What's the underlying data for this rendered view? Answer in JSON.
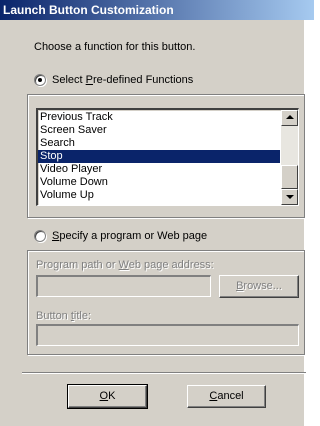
{
  "window": {
    "title": "Launch Button Customization"
  },
  "prompt": "Choose a function for this button.",
  "predefined": {
    "label_pre": "Select ",
    "label_accel": "P",
    "label_post": "re-defined Functions",
    "selected": true,
    "items": [
      {
        "label": "Previous Track",
        "selected": false
      },
      {
        "label": "Screen Saver",
        "selected": false
      },
      {
        "label": "Search",
        "selected": false
      },
      {
        "label": "Stop",
        "selected": true
      },
      {
        "label": "Video Player",
        "selected": false
      },
      {
        "label": "Volume Down",
        "selected": false
      },
      {
        "label": "Volume Up",
        "selected": false
      }
    ]
  },
  "specify": {
    "label_accel": "S",
    "label_post": "pecify a program or Web page",
    "selected": false,
    "path_label_pre": "Program path or ",
    "path_label_accel": "W",
    "path_label_post": "eb page address:",
    "path_value": "",
    "browse_accel": "B",
    "browse_post": "rowse...",
    "title_label_pre": "Button ",
    "title_label_accel": "t",
    "title_label_post": "itle:",
    "title_value": ""
  },
  "buttons": {
    "ok_accel": "O",
    "ok_post": "K",
    "cancel_accel": "C",
    "cancel_post": "ancel"
  },
  "colors": {
    "title_start": "#0a246a",
    "title_end": "#a6caf0",
    "face": "#d4d0c8",
    "selection": "#0a246a"
  }
}
